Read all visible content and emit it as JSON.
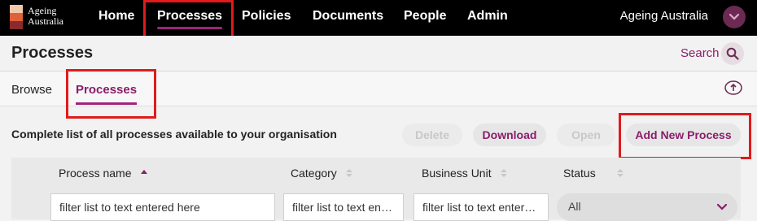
{
  "brand": {
    "logo_line1": "Ageing",
    "logo_line2": "Australia"
  },
  "nav": {
    "items": [
      {
        "label": "Home"
      },
      {
        "label": "Processes"
      },
      {
        "label": "Policies"
      },
      {
        "label": "Documents"
      },
      {
        "label": "People"
      },
      {
        "label": "Admin"
      }
    ],
    "account_name": "Ageing Australia"
  },
  "header": {
    "title": "Processes",
    "search_label": "Search"
  },
  "tabs": [
    {
      "label": "Browse"
    },
    {
      "label": "Processes"
    }
  ],
  "toolbar": {
    "description": "Complete list of all processes available to your organisation",
    "buttons": [
      {
        "label": "Delete"
      },
      {
        "label": "Download"
      },
      {
        "label": "Open"
      },
      {
        "label": "Add New Process"
      }
    ]
  },
  "table": {
    "columns": [
      {
        "label": "Process name"
      },
      {
        "label": "Category"
      },
      {
        "label": "Business Unit"
      },
      {
        "label": "Status"
      }
    ],
    "filters": {
      "process_name_placeholder": "filter list to text entered here",
      "category_placeholder": "filter list to text entered here",
      "business_unit_placeholder": "filter list to text entered here",
      "status_selected": "All"
    }
  },
  "colors": {
    "accent": "#8a1c6a",
    "highlight": "#e01b1b",
    "topbar": "#000000"
  }
}
